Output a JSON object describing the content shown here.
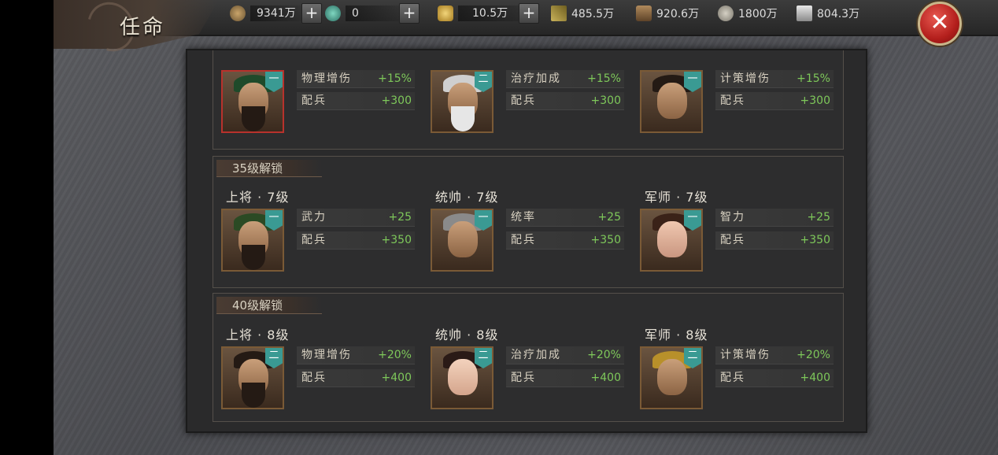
{
  "header": {
    "title": "任命",
    "copper": "9341万",
    "jade": "0",
    "gold": "10.5万",
    "grain": "485.5万",
    "wood": "920.6万",
    "stone": "1800万",
    "iron": "804.3万",
    "plus": "+",
    "close": "✕"
  },
  "sections": [
    {
      "unlock": "",
      "slots": [
        {
          "role": "",
          "badge": "一",
          "attr1": "物理增伤",
          "val1": "+15%",
          "attr2": "配兵",
          "val2": "+300"
        },
        {
          "role": "",
          "badge": "二",
          "attr1": "治疗加成",
          "val1": "+15%",
          "attr2": "配兵",
          "val2": "+300"
        },
        {
          "role": "",
          "badge": "一",
          "attr1": "计策增伤",
          "val1": "+15%",
          "attr2": "配兵",
          "val2": "+300"
        }
      ]
    },
    {
      "unlock": "35级解锁",
      "slots": [
        {
          "role": "上将 · 7级",
          "badge": "一",
          "attr1": "武力",
          "val1": "+25",
          "attr2": "配兵",
          "val2": "+350"
        },
        {
          "role": "统帅 · 7级",
          "badge": "一",
          "attr1": "统率",
          "val1": "+25",
          "attr2": "配兵",
          "val2": "+350"
        },
        {
          "role": "军师 · 7级",
          "badge": "一",
          "attr1": "智力",
          "val1": "+25",
          "attr2": "配兵",
          "val2": "+350"
        }
      ]
    },
    {
      "unlock": "40级解锁",
      "slots": [
        {
          "role": "上将 · 8级",
          "badge": "二",
          "attr1": "物理增伤",
          "val1": "+20%",
          "attr2": "配兵",
          "val2": "+400"
        },
        {
          "role": "统帅 · 8级",
          "badge": "二",
          "attr1": "治疗加成",
          "val1": "+20%",
          "attr2": "配兵",
          "val2": "+400"
        },
        {
          "role": "军师 · 8级",
          "badge": "二",
          "attr1": "计策增伤",
          "val1": "+20%",
          "attr2": "配兵",
          "val2": "+400"
        }
      ]
    }
  ],
  "colors": {
    "accent": "#3a9a93",
    "positive": "#7ec85a",
    "close": "#b31f1c"
  },
  "icons": [
    "copper-coin-icon",
    "jade-icon",
    "gold-ingot-icon",
    "grain-icon",
    "wood-icon",
    "stone-icon",
    "iron-icon",
    "close-icon"
  ]
}
